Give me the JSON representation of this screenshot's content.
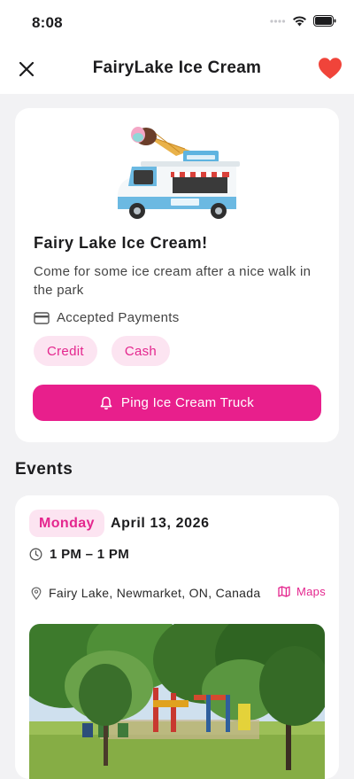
{
  "status_bar": {
    "time": "8:08"
  },
  "nav": {
    "title": "FairyLake Ice Cream",
    "close_icon": "close-icon",
    "favorite_icon": "heart-icon",
    "favorite_color": "#f0443a"
  },
  "truck": {
    "title": "Fairy Lake Ice Cream!",
    "description": "Come for some ice cream after a nice walk in the park",
    "payments_label": "Accepted Payments",
    "payment_methods": [
      "Credit",
      "Cash"
    ],
    "ping_button_label": "Ping Ice Cream Truck"
  },
  "events": {
    "section_title": "Events",
    "items": [
      {
        "day": "Monday",
        "date": "April 13, 2026",
        "time": "1 PM – 1 PM",
        "location": "Fairy Lake, Newmarket, ON, Canada",
        "maps_label": "Maps"
      }
    ]
  },
  "colors": {
    "accent": "#e81f8c",
    "accent_soft": "#fce4f1",
    "background": "#f2f2f4"
  }
}
